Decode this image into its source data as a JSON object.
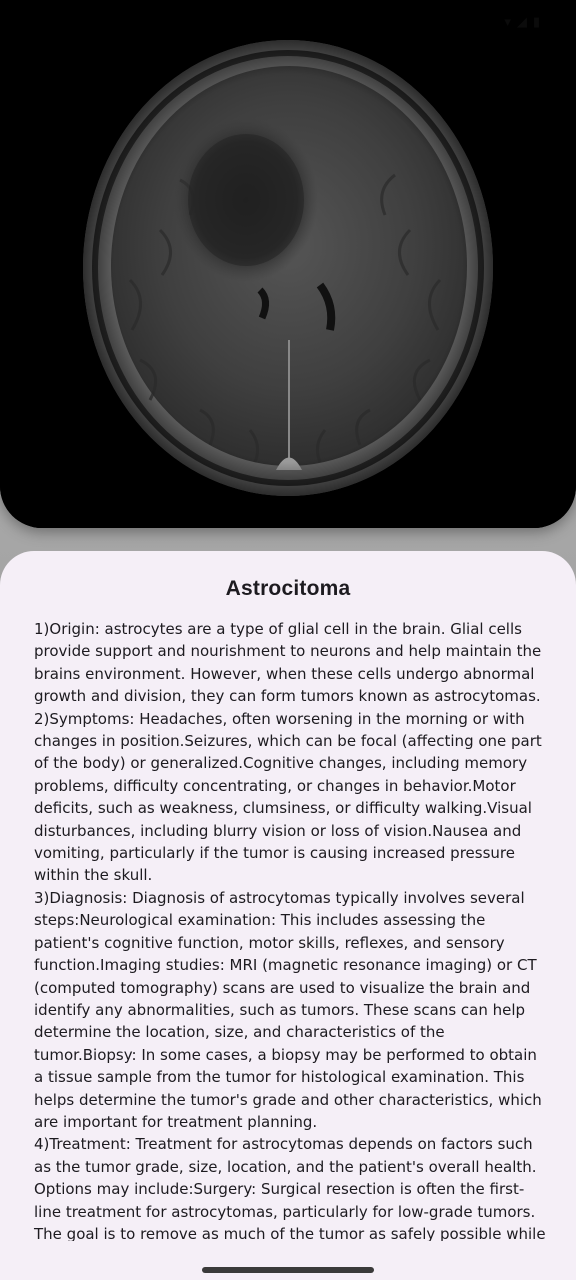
{
  "status_bar": {
    "time": "",
    "icons": [
      "wifi-icon",
      "signal-icon",
      "battery-icon"
    ]
  },
  "mri_image": {
    "description_icon": "brain-mri-scan"
  },
  "tumor": {
    "title": "Astrocitoma",
    "paragraphs": [
      "1)Origin:  astrocytes are a type of glial cell in the brain. Glial cells provide support and nourishment to neurons and help maintain the brains environment. However, when these cells undergo abnormal growth and division, they can form tumors known as astrocytomas.",
      "2)Symptoms:  Headaches, often worsening in the morning or with changes in position.Seizures, which can be focal (affecting one part of the body) or generalized.Cognitive changes, including memory problems, difficulty concentrating, or changes in behavior.Motor deficits, such as weakness, clumsiness, or difficulty walking.Visual disturbances, including blurry vision or loss of vision.Nausea and vomiting, particularly if the tumor is causing increased pressure within the skull.",
      "3)Diagnosis: Diagnosis of astrocytomas typically involves several steps:Neurological examination: This includes assessing the patient's cognitive function, motor skills, reflexes, and sensory function.Imaging studies: MRI (magnetic resonance imaging) or CT (computed tomography) scans are used to visualize the brain and identify any abnormalities, such as tumors. These scans can help determine the location, size, and characteristics of the tumor.Biopsy: In some cases, a biopsy may be performed to obtain a tissue sample from the tumor for histological examination. This helps determine the tumor's grade and other characteristics, which are important for treatment planning.",
      "4)Treatment: Treatment for astrocytomas depends on factors such as the tumor grade, size, location, and the patient's overall health. Options may include:Surgery: Surgical resection is often the first-line treatment for astrocytomas, particularly for low-grade tumors. The goal is to remove as much of the tumor as safely possible while"
    ]
  },
  "colors": {
    "sheet_background": "#f5eff7",
    "text": "#1d1b20",
    "image_background": "#000000"
  }
}
